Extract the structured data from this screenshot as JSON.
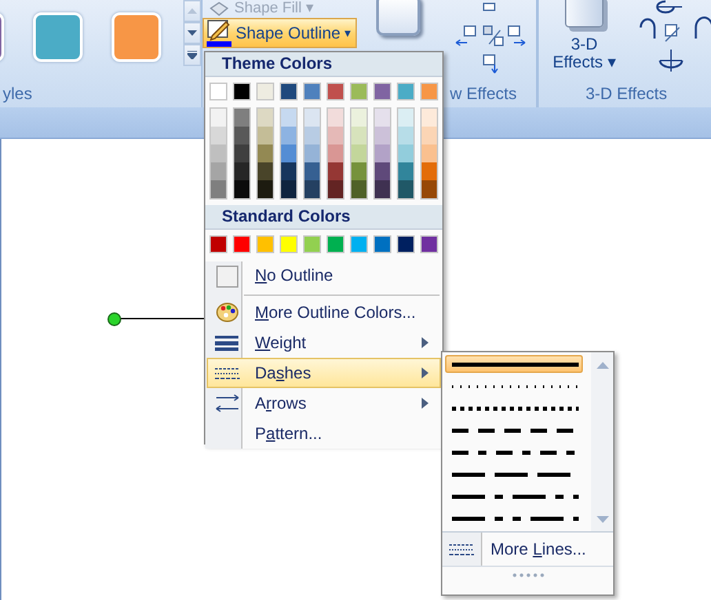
{
  "ribbon": {
    "style_gallery": [
      {
        "color": "#8064a2"
      },
      {
        "color": "#4bacc6"
      },
      {
        "color": "#f79646"
      }
    ],
    "shape_fill": {
      "label": "Shape Fill",
      "caret": "▾"
    },
    "shape_outline": {
      "label": "Shape Outline",
      "caret": "▾",
      "selected": true
    },
    "three_d_button": {
      "label_1": "3-D",
      "label_2": "Effects",
      "caret": "▾"
    },
    "group_labels": [
      "yles",
      "w Effects",
      "3-D Effects"
    ]
  },
  "outline_menu": {
    "theme_header": "Theme Colors",
    "theme_colors": [
      {
        "color": "#ffffff",
        "shades": [
          {
            "color": "#f2f2f2"
          },
          {
            "color": "#d8d8d8"
          },
          {
            "color": "#bfbfbf"
          },
          {
            "color": "#a5a5a5"
          },
          {
            "color": "#7f7f7f"
          }
        ]
      },
      {
        "color": "#000000",
        "shades": [
          {
            "color": "#7f7f7f"
          },
          {
            "color": "#595959"
          },
          {
            "color": "#3f3f3f"
          },
          {
            "color": "#262626"
          },
          {
            "color": "#0c0c0c"
          }
        ]
      },
      {
        "color": "#eeece1",
        "shades": [
          {
            "color": "#ddd9c3"
          },
          {
            "color": "#c4bd97"
          },
          {
            "color": "#938953"
          },
          {
            "color": "#494429"
          },
          {
            "color": "#1d1b10"
          }
        ]
      },
      {
        "color": "#1f497d",
        "shades": [
          {
            "color": "#c6d9f0"
          },
          {
            "color": "#8db3e2"
          },
          {
            "color": "#548dd4"
          },
          {
            "color": "#17365d"
          },
          {
            "color": "#0f243e"
          }
        ]
      },
      {
        "color": "#4f81bd",
        "shades": [
          {
            "color": "#dbe5f1"
          },
          {
            "color": "#b8cce4"
          },
          {
            "color": "#95b3d7"
          },
          {
            "color": "#366092"
          },
          {
            "color": "#244061"
          }
        ]
      },
      {
        "color": "#c0504d",
        "shades": [
          {
            "color": "#f2dcdb"
          },
          {
            "color": "#e5b9b7"
          },
          {
            "color": "#d99694"
          },
          {
            "color": "#953734"
          },
          {
            "color": "#632423"
          }
        ]
      },
      {
        "color": "#9bbb59",
        "shades": [
          {
            "color": "#ebf1dd"
          },
          {
            "color": "#d7e3bc"
          },
          {
            "color": "#c3d69b"
          },
          {
            "color": "#76923c"
          },
          {
            "color": "#4f6128"
          }
        ]
      },
      {
        "color": "#8064a2",
        "shades": [
          {
            "color": "#e5e0ec"
          },
          {
            "color": "#ccc1d9"
          },
          {
            "color": "#b2a2c7"
          },
          {
            "color": "#5f497a"
          },
          {
            "color": "#3f3151"
          }
        ]
      },
      {
        "color": "#4bacc6",
        "shades": [
          {
            "color": "#dbeef3"
          },
          {
            "color": "#b7dde8"
          },
          {
            "color": "#92cddc"
          },
          {
            "color": "#31859b"
          },
          {
            "color": "#205867"
          }
        ]
      },
      {
        "color": "#f79646",
        "shades": [
          {
            "color": "#fdeada"
          },
          {
            "color": "#fbd5b5"
          },
          {
            "color": "#fac08f"
          },
          {
            "color": "#e36c09"
          },
          {
            "color": "#974806"
          }
        ]
      }
    ],
    "standard_header": "Standard Colors",
    "standard_colors": [
      {
        "color": "#c00000"
      },
      {
        "color": "#ff0000"
      },
      {
        "color": "#ffc000"
      },
      {
        "color": "#ffff00"
      },
      {
        "color": "#92d050"
      },
      {
        "color": "#00b050"
      },
      {
        "color": "#00b0f0"
      },
      {
        "color": "#0070c0"
      },
      {
        "color": "#002060"
      },
      {
        "color": "#7030a0"
      }
    ],
    "items": [
      {
        "kind": "no-outline",
        "key": "N",
        "after": "o Outline",
        "submenu": false,
        "selected": false,
        "separator_after": true
      },
      {
        "kind": "palette",
        "key": "M",
        "after": "ore Outline Colors...",
        "submenu": false,
        "selected": false,
        "separator_after": false
      },
      {
        "kind": "weight",
        "key": "W",
        "after": "eight",
        "submenu": true,
        "selected": false,
        "separator_after": false
      },
      {
        "kind": "dashes",
        "before": "Da",
        "key": "s",
        "after": "hes",
        "submenu": true,
        "selected": true,
        "separator_after": false
      },
      {
        "kind": "arrows",
        "before": "A",
        "key": "r",
        "after": "rows",
        "submenu": true,
        "selected": false,
        "separator_after": false
      },
      {
        "kind": "plain",
        "before": "P",
        "key": "a",
        "after": "ttern...",
        "submenu": false,
        "selected": false,
        "separator_after": false
      }
    ]
  },
  "dashes_menu": {
    "styles": [
      {
        "kind": "solid",
        "selected": true
      },
      {
        "kind": "round-dot",
        "selected": false
      },
      {
        "kind": "square-dot",
        "selected": false
      },
      {
        "kind": "dash",
        "selected": false
      },
      {
        "kind": "dash-dot",
        "selected": false
      },
      {
        "kind": "long-dash",
        "selected": false
      },
      {
        "kind": "long-dash-dot",
        "selected": false
      },
      {
        "kind": "long-dash-dot-dot",
        "selected": false
      }
    ],
    "more_lines": {
      "before": "More ",
      "key": "L",
      "after": "ines..."
    }
  }
}
